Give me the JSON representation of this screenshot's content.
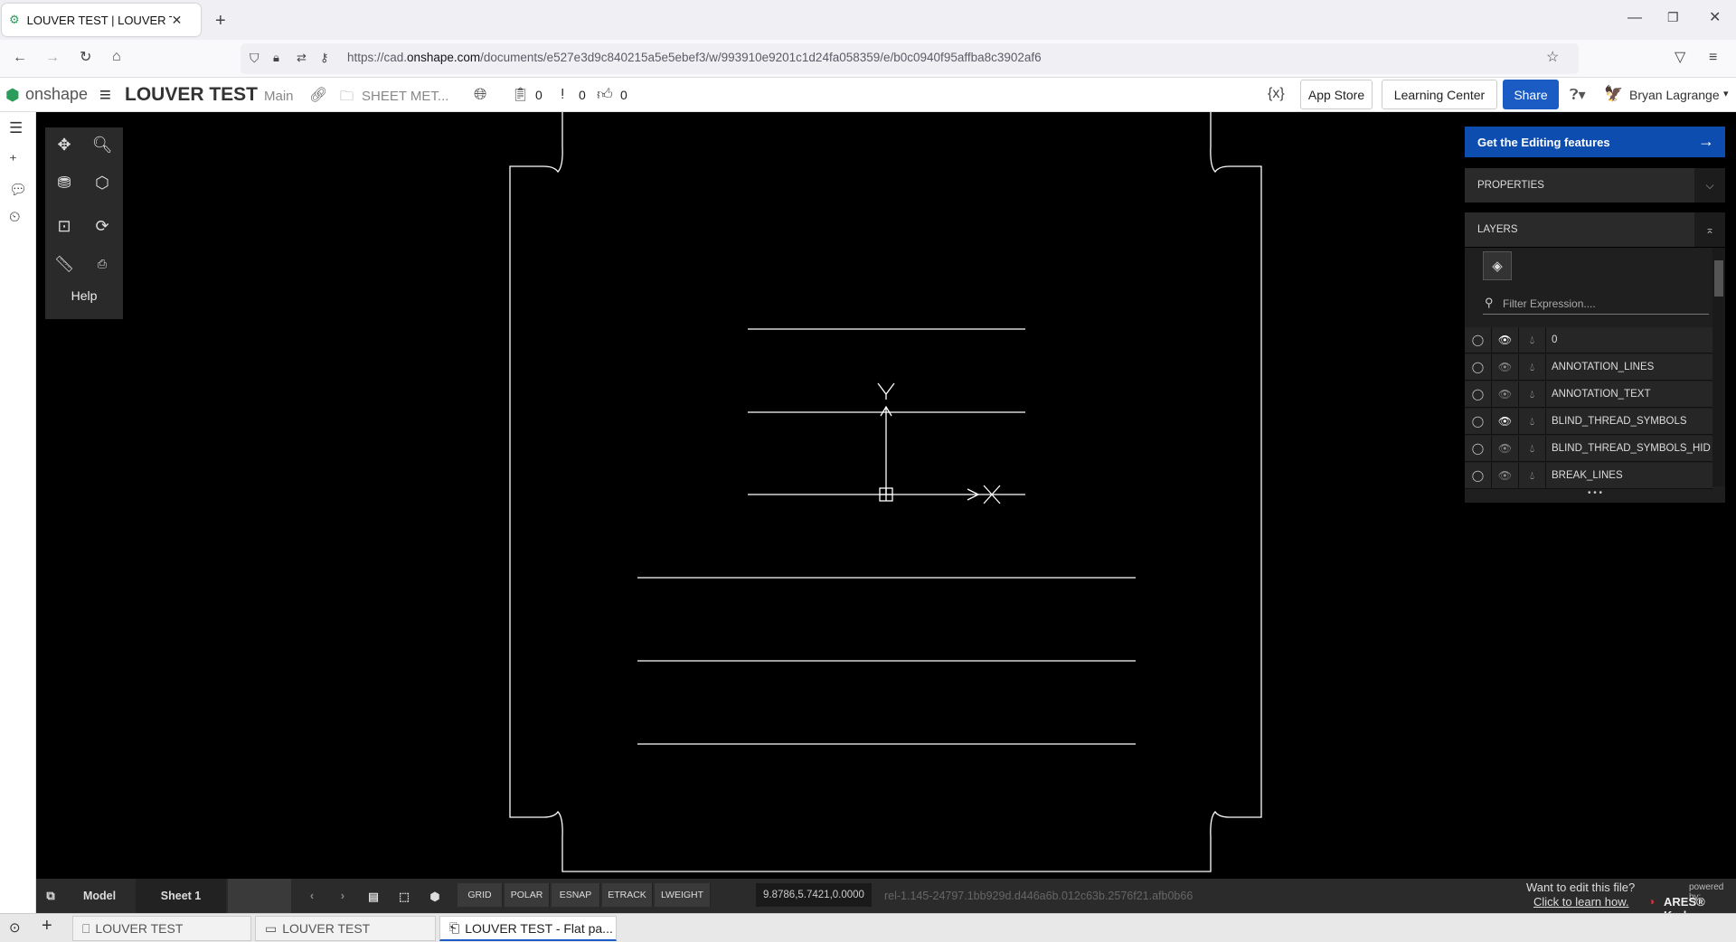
{
  "browser": {
    "tab_title": "LOUVER TEST | LOUVER TEST - F",
    "url_prefix": "https://cad.",
    "url_domain": "onshape.com",
    "url_rest": "/documents/e527e3d9c840215a5e5ebef3/w/993910e9201c1d24fa058359/e/b0c0940f95affba8c3902af6"
  },
  "header": {
    "brand": "onshape",
    "doc_title": "LOUVER TEST",
    "branch": "Main",
    "folder": "SHEET MET...",
    "versions_count": "0",
    "branches_count": "0",
    "likes_count": "0",
    "app_store": "App Store",
    "learning_center": "Learning Center",
    "share": "Share",
    "user": "Bryan Lagrange"
  },
  "toolbar": {
    "help": "Help"
  },
  "panel": {
    "edit_banner": "Get the Editing features",
    "properties": "PROPERTIES",
    "layers": "LAYERS",
    "filter_placeholder": "Filter Expression....",
    "layer_rows": [
      {
        "name": "0",
        "visible": true
      },
      {
        "name": "ANNOTATION_LINES",
        "visible": false
      },
      {
        "name": "ANNOTATION_TEXT",
        "visible": false
      },
      {
        "name": "BLIND_THREAD_SYMBOLS",
        "visible": true
      },
      {
        "name": "BLIND_THREAD_SYMBOLS_HIDDE",
        "visible": false
      },
      {
        "name": "BREAK_LINES",
        "visible": false
      }
    ],
    "more": "• • •"
  },
  "status": {
    "model_tab": "Model",
    "sheet_tab": "Sheet 1",
    "grid": "GRID",
    "polar": "POLAR",
    "esnap": "ESNAP",
    "etrack": "ETRACK",
    "lweight": "LWEIGHT",
    "coords": "9.8786,5.7421,0.0000",
    "hash": "rel-1.145-24797.1bb929d.d446a6b.012c63b.2576f21.afb0b66",
    "edit_question": "Want to edit this file?",
    "learn_link": "Click to learn how.",
    "powered_by": "powered by:",
    "kudo": "ARES® Kudo"
  },
  "doc_tabs": [
    {
      "label": "LOUVER TEST"
    },
    {
      "label": "LOUVER TEST"
    },
    {
      "label": "LOUVER TEST - Flat pa..."
    }
  ],
  "colors": {
    "accent": "#0d4db0",
    "share": "#1a5bc4"
  }
}
